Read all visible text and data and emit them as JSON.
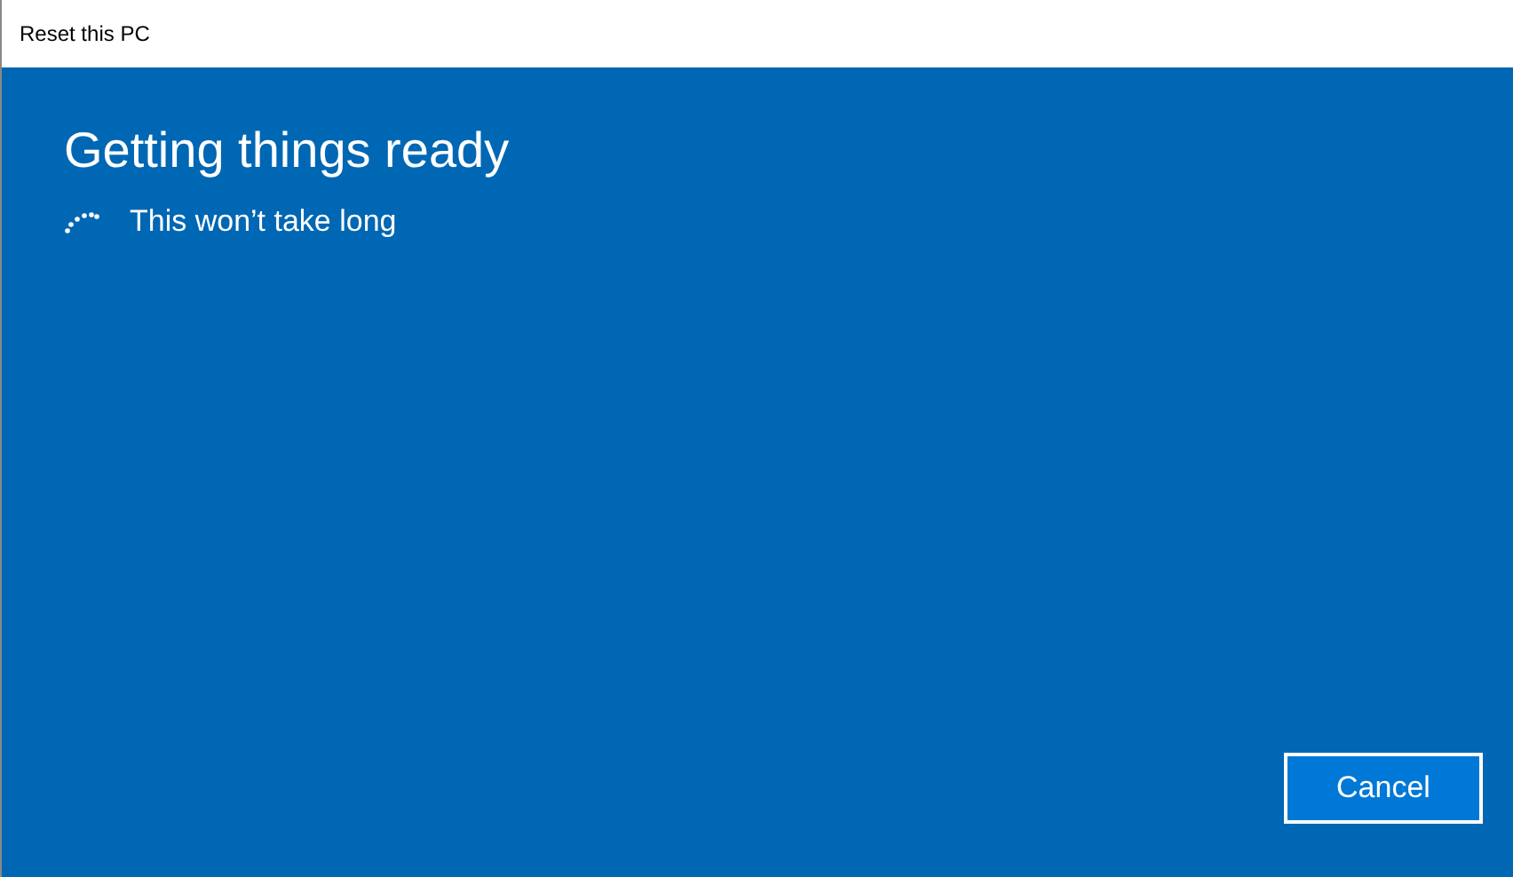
{
  "window": {
    "title": "Reset this PC"
  },
  "heading": "Getting things ready",
  "status": {
    "text": "This won’t take long"
  },
  "buttons": [
    {
      "label": "Cancel"
    }
  ]
}
